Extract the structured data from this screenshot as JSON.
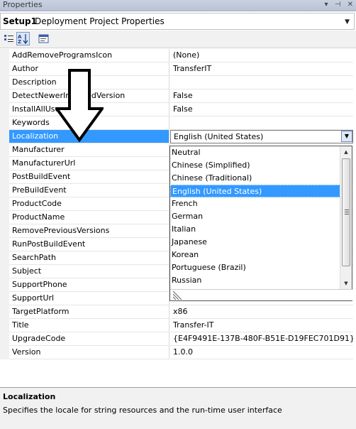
{
  "window": {
    "title": "Properties"
  },
  "object_selector": {
    "name": "Setup1",
    "type": "Deployment Project Properties"
  },
  "toolbar": {
    "categorized_icon": "categorized-icon",
    "alphabetical_icon": "alphabetical-icon",
    "property_pages_icon": "property-pages-icon"
  },
  "properties": [
    {
      "name": "AddRemoveProgramsIcon",
      "value": "(None)"
    },
    {
      "name": "Author",
      "value": "TransferIT"
    },
    {
      "name": "Description",
      "value": ""
    },
    {
      "name": "DetectNewerInstalledVersion",
      "value": "False"
    },
    {
      "name": "InstallAllUsers",
      "value": "False"
    },
    {
      "name": "Keywords",
      "value": ""
    },
    {
      "name": "Localization",
      "value": "English (United States)"
    },
    {
      "name": "Manufacturer",
      "value": ""
    },
    {
      "name": "ManufacturerUrl",
      "value": ""
    },
    {
      "name": "PostBuildEvent",
      "value": ""
    },
    {
      "name": "PreBuildEvent",
      "value": ""
    },
    {
      "name": "ProductCode",
      "value": ""
    },
    {
      "name": "ProductName",
      "value": ""
    },
    {
      "name": "RemovePreviousVersions",
      "value": ""
    },
    {
      "name": "RunPostBuildEvent",
      "value": ""
    },
    {
      "name": "SearchPath",
      "value": ""
    },
    {
      "name": "Subject",
      "value": ""
    },
    {
      "name": "SupportPhone",
      "value": ""
    },
    {
      "name": "SupportUrl",
      "value": ""
    },
    {
      "name": "TargetPlatform",
      "value": "x86"
    },
    {
      "name": "Title",
      "value": "Transfer-IT"
    },
    {
      "name": "UpgradeCode",
      "value": "{E4F9491E-137B-480F-B51E-D19FEC701D91}"
    },
    {
      "name": "Version",
      "value": "1.0.0"
    }
  ],
  "selected_property": "Localization",
  "localization_options": [
    "Neutral",
    "Chinese (Simplified)",
    "Chinese (Traditional)",
    "English (United States)",
    "French",
    "German",
    "Italian",
    "Japanese",
    "Korean",
    "Portuguese (Brazil)",
    "Russian"
  ],
  "selected_option": "English (United States)",
  "description": {
    "title": "Localization",
    "text": "Specifies the locale for string resources and the run-time user interface"
  },
  "colors": {
    "selection": "#3399ff",
    "gutter": "#f1f1f1"
  }
}
